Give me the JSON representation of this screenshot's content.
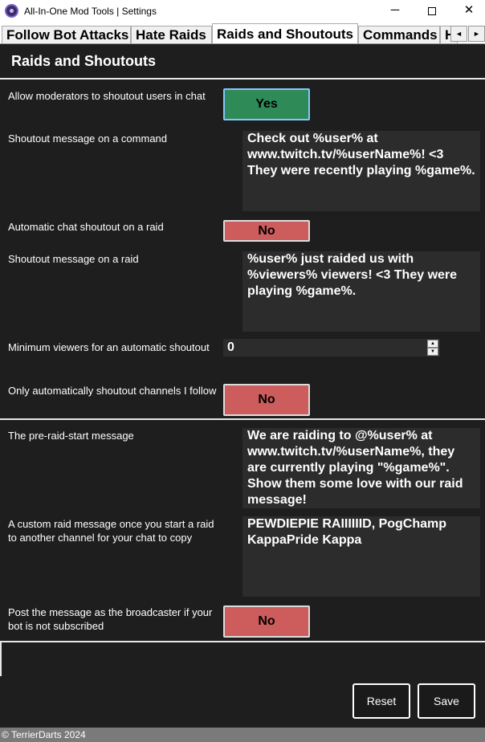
{
  "window": {
    "title": "All-In-One Mod Tools | Settings",
    "minimize_glyph": "─",
    "close_glyph": "✕"
  },
  "tabs": [
    {
      "label": "Follow Bot Attacks"
    },
    {
      "label": "Hate Raids"
    },
    {
      "label": "Raids and Shoutouts",
      "active": true
    },
    {
      "label": "Commands"
    },
    {
      "label": "H"
    }
  ],
  "tab_scroll": {
    "left": "◄",
    "right": "►"
  },
  "page": {
    "title": "Raids and Shoutouts",
    "settings": {
      "allow_mod_shoutout": {
        "label": "Allow moderators to shoutout users in chat",
        "value": "Yes"
      },
      "shoutout_command_message": {
        "label": "Shoutout message on a command",
        "value": "Check out %user% at www.twitch.tv/%userName%! <3 They were recently playing %game%."
      },
      "auto_shoutout_on_raid": {
        "label": "Automatic chat shoutout on a raid",
        "value": "No"
      },
      "shoutout_raid_message": {
        "label": "Shoutout message on a raid",
        "value": "%user% just raided us with %viewers% viewers! <3 They were playing %game%."
      },
      "min_viewers": {
        "label": "Minimum viewers for an automatic shoutout",
        "value": "0"
      },
      "only_followed_channels": {
        "label": "Only automatically shoutout channels I follow",
        "value": "No"
      },
      "pre_raid_message": {
        "label": "The pre-raid-start message",
        "value": "We are raiding to @%user% at www.twitch.tv/%userName%, they are currently playing \"%game%\". Show them some love with our raid message!"
      },
      "custom_raid_message": {
        "label": "A custom raid message once you start a raid to another channel for your chat to copy",
        "value": "PEWDIEPIE RAIIIIIID, PogChamp KappaPride Kappa"
      },
      "post_as_broadcaster": {
        "label": "Post the message as the broadcaster if your bot is not subscribed",
        "value": "No"
      }
    }
  },
  "buttons": {
    "reset": "Reset",
    "save": "Save"
  },
  "statusbar": {
    "text": "© TerrierDarts 2024"
  },
  "colors": {
    "yes": "#2e8b57",
    "no": "#cd5c5c",
    "background": "#1e1e1e",
    "field": "#2c2c2c"
  }
}
